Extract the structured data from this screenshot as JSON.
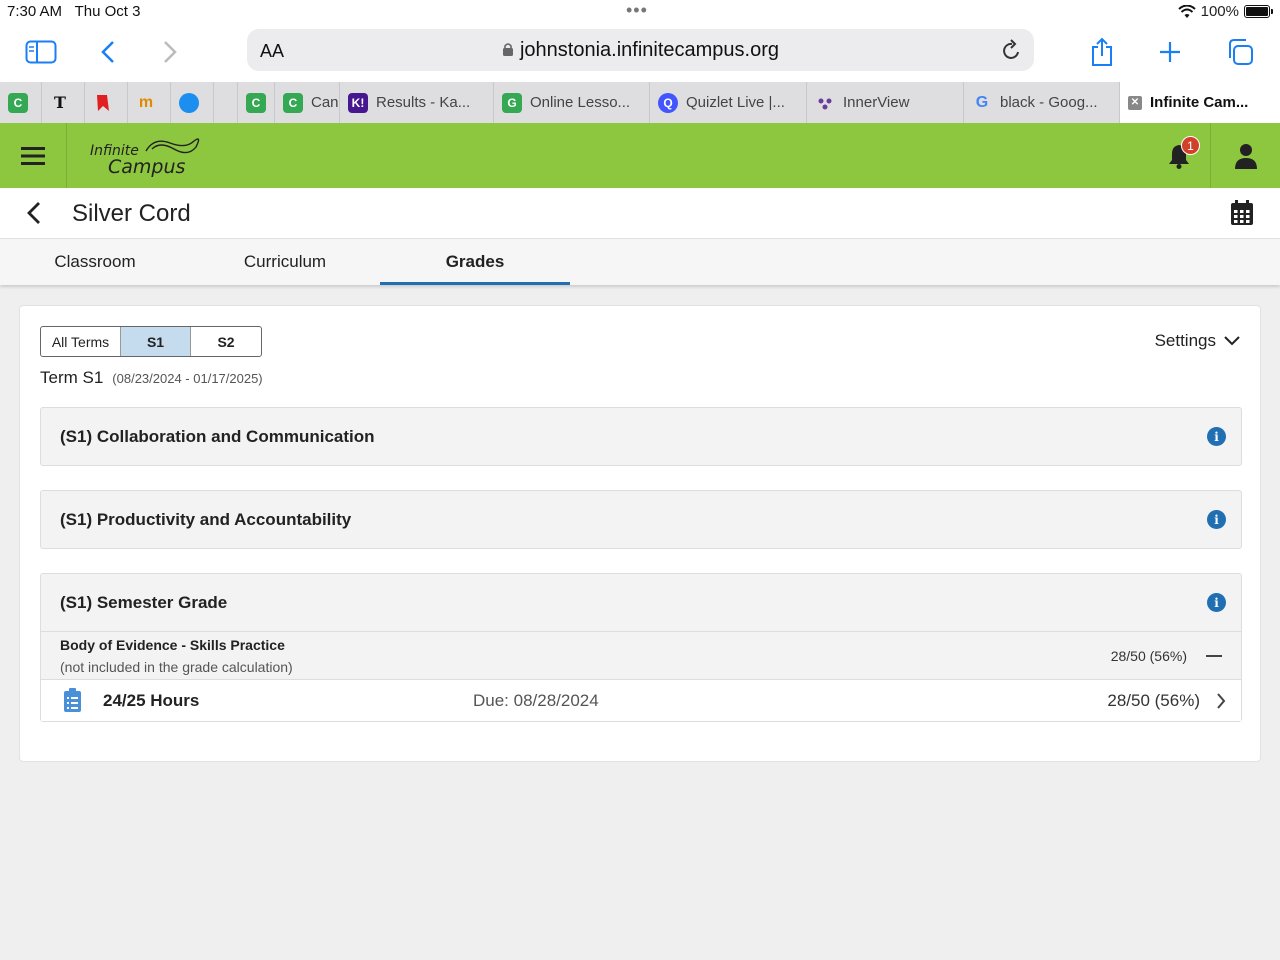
{
  "status": {
    "time": "7:30 AM",
    "date": "Thu Oct 3",
    "battery": "100%"
  },
  "browser": {
    "text_size_label": "AA",
    "url": "johnstonia.infinitecampus.org",
    "tabs": [
      {
        "label": "",
        "favicon": "C",
        "color": "#34a853"
      },
      {
        "label": "",
        "favicon": "T",
        "color": "#ffffff"
      },
      {
        "label": "",
        "favicon": "bookmark",
        "color": "#e02020"
      },
      {
        "label": "",
        "favicon": "m",
        "color": "#ffffff"
      },
      {
        "label": "",
        "favicon": "blue-circle",
        "color": "#1c8ef0"
      },
      {
        "label": "",
        "favicon": "",
        "color": ""
      },
      {
        "label": "",
        "favicon": "C",
        "color": "#34a853"
      },
      {
        "label": "Can",
        "favicon": "C",
        "color": "#34a853"
      },
      {
        "label": "Results - Ka...",
        "favicon": "K!",
        "color": "#46178f"
      },
      {
        "label": "Online Lesso...",
        "favicon": "G",
        "color": "#34a853"
      },
      {
        "label": "Quizlet Live |...",
        "favicon": "Q",
        "color": "#4255ff"
      },
      {
        "label": "InnerView",
        "favicon": "flower",
        "color": "#6a3d9a"
      },
      {
        "label": "black - Goog...",
        "favicon": "G",
        "color": "#4285f4"
      },
      {
        "label": "Infinite Cam...",
        "favicon": "close-x",
        "color": "#777777"
      }
    ]
  },
  "app": {
    "logo_line1": "Infinite",
    "logo_line2": "Campus",
    "notification_count": "1",
    "accent": "#8dc63f"
  },
  "page": {
    "title": "Silver Cord",
    "nav_tabs": [
      "Classroom",
      "Curriculum",
      "Grades"
    ],
    "active_tab": "Grades"
  },
  "grades": {
    "term_filters": [
      "All Terms",
      "S1",
      "S2"
    ],
    "selected_term": "S1",
    "settings_label": "Settings",
    "term_label": "Term S1",
    "term_range": "(08/23/2024 - 01/17/2025)",
    "sections": [
      {
        "title": "(S1) Collaboration and Communication"
      },
      {
        "title": "(S1) Productivity and Accountability"
      },
      {
        "title": "(S1) Semester Grade"
      }
    ],
    "category": {
      "name": "Body of Evidence - Skills Practice",
      "note": "(not included in the grade calculation)",
      "score": "28/50  (56%)"
    },
    "assignment": {
      "name": "24/25 Hours",
      "due": "Due: 08/28/2024",
      "score": "28/50  (56%)"
    }
  }
}
